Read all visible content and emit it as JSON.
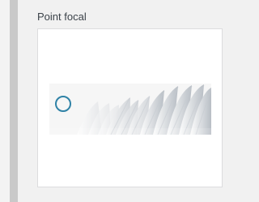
{
  "settings": {
    "section_title": "Point focal"
  },
  "preview": {
    "icon": "focal-point-icon",
    "accent_color": "#2f82a6"
  }
}
